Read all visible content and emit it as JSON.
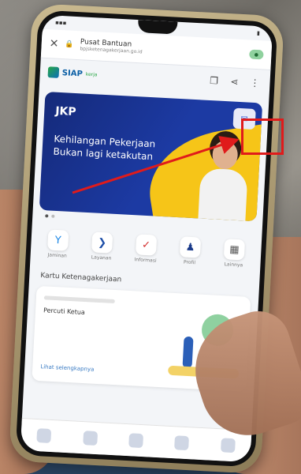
{
  "browser": {
    "url_title": "Pusat Bantuan",
    "url_sub": "bpjsketenagakerjaan.go.id"
  },
  "app": {
    "logo_text": "SIAP",
    "logo_sub": "kerja"
  },
  "banner": {
    "brand": "JKP",
    "headline": "Kehilangan Pekerjaan Bukan lagi ketakutan"
  },
  "menu": {
    "items": [
      {
        "label": "Jaminan",
        "icon": "y-icon",
        "color": "#1e88e5"
      },
      {
        "label": "Layanan",
        "icon": "arrow-icon",
        "color": "#1e4fa8"
      },
      {
        "label": "Informasi",
        "icon": "check-icon",
        "color": "#d32f2f"
      },
      {
        "label": "Profil",
        "icon": "person-icon",
        "color": "#1a3a8a"
      },
      {
        "label": "Lainnya",
        "icon": "grid-icon",
        "color": "#555555"
      }
    ]
  },
  "section": {
    "title": "Kartu Ketenagakerjaan"
  },
  "card": {
    "title": "Percuti Ketua",
    "link": "Lihat selengkapnya"
  },
  "annotation_color": "#e01b1b"
}
